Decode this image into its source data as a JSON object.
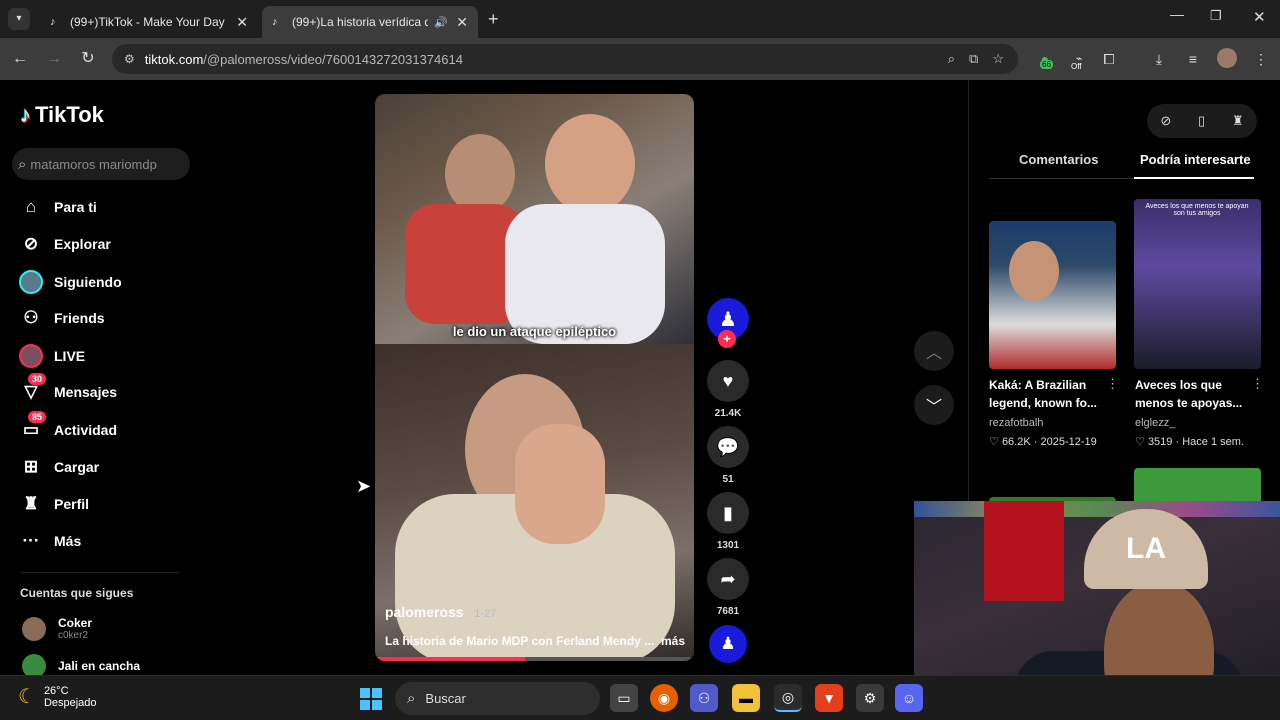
{
  "browser": {
    "tabs": [
      {
        "title": "(99+)TikTok - Make Your Day"
      },
      {
        "title": "(99+)La historia verídica de"
      }
    ],
    "url_host": "tiktok.com",
    "url_path": "/@palomeross/video/7600143272031374614",
    "extension_badge": "66",
    "extension_off": "Off"
  },
  "sidebar": {
    "logo": "TikTok",
    "search_placeholder": "matamoros mariomdp",
    "items": [
      {
        "label": "Para ti",
        "icon": "home-icon"
      },
      {
        "label": "Explorar",
        "icon": "compass-icon"
      },
      {
        "label": "Siguiendo",
        "icon": "following-avatar-icon"
      },
      {
        "label": "Friends",
        "icon": "friends-icon"
      },
      {
        "label": "LIVE",
        "icon": "live-icon"
      },
      {
        "label": "Mensajes",
        "icon": "messages-icon",
        "badge": "30"
      },
      {
        "label": "Actividad",
        "icon": "activity-icon",
        "badge": "85"
      },
      {
        "label": "Cargar",
        "icon": "upload-icon"
      },
      {
        "label": "Perfil",
        "icon": "profile-icon"
      },
      {
        "label": "Más",
        "icon": "more-icon"
      }
    ],
    "following_title": "Cuentas que sigues",
    "following": [
      {
        "name": "Coker",
        "handle": "c0ker2"
      },
      {
        "name": "Jali en cancha",
        "handle": ""
      }
    ]
  },
  "video": {
    "caption": "le dio un ataque epiléptico",
    "author": "palomeross",
    "duration": "· 1-27",
    "description": "La historia de Mario MDP con Ferland Mendy ...",
    "more_label": "más",
    "progress": 0.47,
    "likes": "21.4K",
    "comments": "51",
    "saves": "1301",
    "shares": "7681"
  },
  "right_panel": {
    "tabs": [
      "Comentarios",
      "Podría interesarte"
    ],
    "cards": [
      {
        "title": "Kaká: A Brazilian legend, known fo...",
        "author": "rezafotbalh",
        "likes": "66.2K",
        "date": "2025-12-19"
      },
      {
        "title": "Aveces los que menos te apoyas...",
        "author": "elglezz_",
        "likes": "3519",
        "date": "Hace 1 sem."
      }
    ],
    "thumb2_overlay": "Aveces los que menos te apoyan son tus amigos"
  },
  "webcam": {
    "cap_text": "LA"
  },
  "taskbar": {
    "temperature": "26°C",
    "weather": "Despejado",
    "search_label": "Buscar"
  },
  "colors": {
    "accent": "#fe2c55",
    "cyan": "#25f4ee",
    "creator_blue": "#1a1adb"
  }
}
